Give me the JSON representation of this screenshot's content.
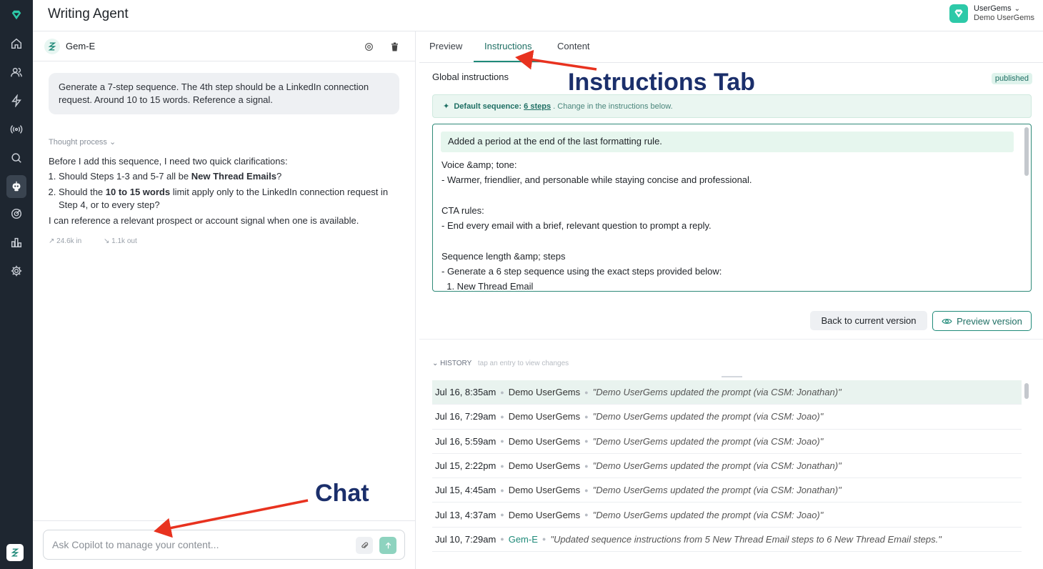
{
  "app": {
    "title": "Writing Agent"
  },
  "org": {
    "name": "UserGems",
    "sub": "Demo UserGems"
  },
  "chat": {
    "agent_name": "Gem-E",
    "user_message": "Generate a 7-step sequence. The 4th step should be a LinkedIn connection request. Around 10 to 15 words. Reference a signal.",
    "thought_label": "Thought process",
    "reply_intro": "Before I add this sequence, I need two quick clarifications:",
    "q1_a": "Should Steps 1-3 and 5-7 all be ",
    "q1_b": "New Thread Emails",
    "q1_c": "?",
    "q2_a": "Should the ",
    "q2_b": "10 to 15 words",
    "q2_c": " limit apply only to the LinkedIn connection request in Step 4, or to every step?",
    "reply_outro": "I can reference a relevant prospect or account signal when one is available.",
    "tokens_in": "24.6k in",
    "tokens_out": "1.1k out",
    "input_placeholder": "Ask Copilot to manage your content..."
  },
  "tabs": [
    "Preview",
    "Instructions",
    "Content"
  ],
  "instructions": {
    "label": "Global instructions",
    "status": "published",
    "default_seq_label": "Default sequence:",
    "default_seq_steps": "6 steps",
    "default_seq_hint": ". Change in the instructions below.",
    "note": "Added a period at the end of the last formatting rule.",
    "body": "Voice &amp; tone:\n- Warmer, friendlier, and personable while staying concise and professional.\n\nCTA rules:\n- End every email with a brief, relevant question to prompt a reply.\n\nSequence length &amp; steps\n- Generate a 6 step sequence using the exact steps provided below:\n  1. New Thread Email",
    "back_button": "Back to current version",
    "preview_button": "Preview version"
  },
  "history": {
    "label": "HISTORY",
    "hint": "tap an entry to view changes",
    "entries": [
      {
        "date": "Jul 16, 8:35am",
        "who": "Demo UserGems",
        "msg": "\"Demo UserGems updated the prompt (via CSM: Jonathan)\""
      },
      {
        "date": "Jul 16, 7:29am",
        "who": "Demo UserGems",
        "msg": "\"Demo UserGems updated the prompt (via CSM: Joao)\""
      },
      {
        "date": "Jul 16, 5:59am",
        "who": "Demo UserGems",
        "msg": "\"Demo UserGems updated the prompt (via CSM: Joao)\""
      },
      {
        "date": "Jul 15, 2:22pm",
        "who": "Demo UserGems",
        "msg": "\"Demo UserGems updated the prompt (via CSM: Jonathan)\""
      },
      {
        "date": "Jul 15, 4:45am",
        "who": "Demo UserGems",
        "msg": "\"Demo UserGems updated the prompt (via CSM: Jonathan)\""
      },
      {
        "date": "Jul 13, 4:37am",
        "who": "Demo UserGems",
        "msg": "\"Demo UserGems updated the prompt (via CSM: Joao)\""
      },
      {
        "date": "Jul 10, 7:29am",
        "who": "Gem-E",
        "msg": "\"Updated sequence instructions from 5 New Thread Email steps to 6 New Thread Email steps.\""
      }
    ]
  },
  "annotations": {
    "instructions": "Instructions Tab",
    "chat": "Chat"
  },
  "colors": {
    "accent": "#1f8a79",
    "rail": "#1e2630",
    "annotation": "#1b2f6b",
    "arrow": "#e8321f"
  }
}
